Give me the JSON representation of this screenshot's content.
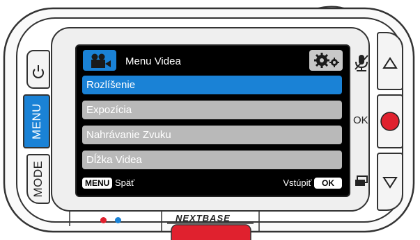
{
  "menu": {
    "title": "Menu Videa",
    "items": [
      {
        "label": "Rozlíšenie",
        "selected": true
      },
      {
        "label": "Expozícia",
        "selected": false
      },
      {
        "label": "Nahrávanie Zvuku",
        "selected": false
      },
      {
        "label": "Dĺžka Videa",
        "selected": false
      }
    ]
  },
  "footer": {
    "menu_key": "MENU",
    "back_label": "Späť",
    "enter_label": "Vstúpiť",
    "ok_key": "OK"
  },
  "device": {
    "menu_button_label": "MENU",
    "mode_button_label": "MODE",
    "ok_label": "OK",
    "brand": "NEXTBASE"
  },
  "colors": {
    "accent_blue": "#1a82d6",
    "record_red": "#e0212e",
    "menu_item_grey": "#b9b9b9",
    "led_red": "#e0212e",
    "led_blue": "#1a82d6"
  },
  "icons": [
    "video-camera-icon",
    "gears-icon",
    "power-icon",
    "mic-muted-icon",
    "arrow-up-icon",
    "arrow-down-icon",
    "record-icon",
    "screen-toggle-icon"
  ]
}
